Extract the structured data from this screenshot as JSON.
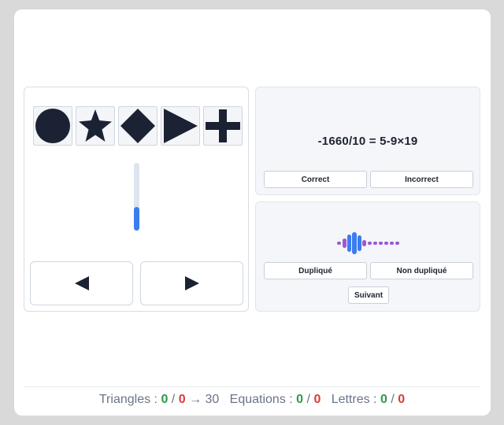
{
  "shapes": {
    "items": [
      {
        "name": "circle"
      },
      {
        "name": "star"
      },
      {
        "name": "diamond"
      },
      {
        "name": "triangle"
      },
      {
        "name": "cross"
      }
    ],
    "color": "#1b2233"
  },
  "slider": {
    "level_fraction": 0.35,
    "accent": "#3b7cf0"
  },
  "navigation": {
    "left_icon": "arrow-left-icon",
    "right_icon": "arrow-right-icon"
  },
  "equation_task": {
    "equation": "-1660/10 = 5-9×19",
    "correct_label": "Correct",
    "incorrect_label": "Incorrect"
  },
  "audio_task": {
    "icon": "audio-waveform-icon",
    "duplicate_label": "Dupliqué",
    "not_duplicate_label": "Non dupliqué",
    "next_label": "Suivant"
  },
  "footer": {
    "triangles_label": "Triangles :",
    "triangles_correct": "0",
    "triangles_errors": "0",
    "triangles_arrow": "→",
    "triangles_target": "30",
    "equations_label": "Equations :",
    "equations_correct": "0",
    "equations_errors": "0",
    "letters_label": "Lettres :",
    "letters_correct": "0",
    "letters_errors": "0",
    "separator": "/",
    "colors": {
      "correct": "#2e9a4a",
      "error": "#d93b3b"
    }
  }
}
